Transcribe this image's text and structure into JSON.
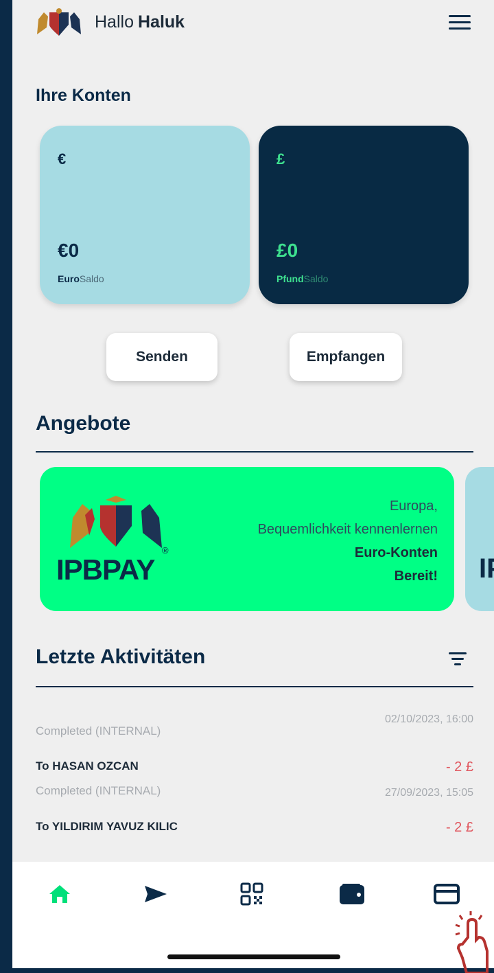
{
  "header": {
    "greeting": "Hallo",
    "user_name": "Haluk"
  },
  "accounts": {
    "title": "Ihre Konten",
    "items": [
      {
        "symbol": "€",
        "balance": "€0",
        "label_bold": "Euro",
        "label_light": "Saldo"
      },
      {
        "symbol": "£",
        "balance": "£0",
        "label_bold": "Pfund",
        "label_light": "Saldo"
      }
    ]
  },
  "actions": {
    "send": "Senden",
    "receive": "Empfangen"
  },
  "offers": {
    "title": "Angebote",
    "card": {
      "brand": "IPBPAY",
      "reg": "®",
      "line1": "Europa,",
      "line2": "Bequemlichkeit kennenlernen",
      "line3": "Euro-Konten",
      "line4": "Bereit!"
    },
    "next_card_fragment": "IP"
  },
  "activity": {
    "title": "Letzte Aktivitäten",
    "items": [
      {
        "title": "",
        "status": "Completed (INTERNAL)",
        "date": "02/10/2023, 16:00",
        "amount": ""
      },
      {
        "title": "To HASAN OZCAN",
        "status": "Completed (INTERNAL)",
        "date": "27/09/2023, 15:05",
        "amount": "- 2 £"
      },
      {
        "title": "To YILDIRIM YAVUZ KILIC",
        "status": "",
        "date": "",
        "amount": "- 2 £"
      }
    ]
  },
  "tabbar": {
    "items": [
      {
        "icon": "home-icon",
        "active": true
      },
      {
        "icon": "send-icon",
        "active": false
      },
      {
        "icon": "qr-code-icon",
        "active": false
      },
      {
        "icon": "wallet-icon",
        "active": false
      },
      {
        "icon": "card-icon",
        "active": false
      }
    ]
  },
  "colors": {
    "accent": "#00ff85",
    "dark": "#0b2a47",
    "light_card": "#a6dbe3",
    "negative": "#e0565e"
  }
}
